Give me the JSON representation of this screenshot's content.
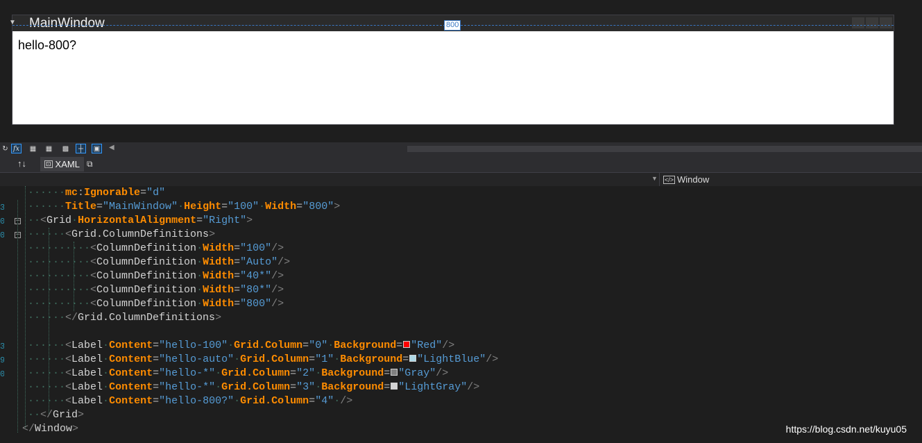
{
  "designer": {
    "window_title": "MainWindow",
    "content_label": "hello-800?",
    "width_badge": "800"
  },
  "toolbar": {
    "icons": [
      "refresh-icon",
      "fx-icon",
      "grid-icon",
      "snap-grid-icon",
      "checkerboard-icon",
      "snap-lines-icon",
      "device-icon"
    ],
    "fx_label": "fx"
  },
  "tabs": {
    "swap_label": "↑↓",
    "xaml_label": "XAML"
  },
  "nav": {
    "right_value": "Window"
  },
  "code": {
    "line_numbers": [
      "",
      "3",
      "0",
      "0",
      "",
      "",
      "",
      "",
      "",
      "",
      "",
      "3",
      "9",
      "0",
      "",
      "",
      "",
      ""
    ],
    "lines": [
      [
        {
          "t": "dots",
          "v": "······"
        },
        {
          "t": "at",
          "v": "mc"
        },
        {
          "t": "eq",
          "v": ":"
        },
        {
          "t": "at",
          "v": "Ignorable"
        },
        {
          "t": "eq",
          "v": "="
        },
        {
          "t": "val",
          "v": "\"d\""
        }
      ],
      [
        {
          "t": "dots",
          "v": "······"
        },
        {
          "t": "at",
          "v": "Title"
        },
        {
          "t": "eq",
          "v": "="
        },
        {
          "t": "val",
          "v": "\"MainWindow\""
        },
        {
          "t": "dots",
          "v": "·"
        },
        {
          "t": "at",
          "v": "Height"
        },
        {
          "t": "eq",
          "v": "="
        },
        {
          "t": "val",
          "v": "\"100\""
        },
        {
          "t": "dots",
          "v": "·"
        },
        {
          "t": "at",
          "v": "Width"
        },
        {
          "t": "eq",
          "v": "="
        },
        {
          "t": "val",
          "v": "\"800\""
        },
        {
          "t": "pn",
          "v": ">"
        }
      ],
      [
        {
          "t": "dots",
          "v": "··"
        },
        {
          "t": "pn",
          "v": "<"
        },
        {
          "t": "el",
          "v": "Grid"
        },
        {
          "t": "dots",
          "v": "·"
        },
        {
          "t": "at",
          "v": "HorizontalAlignment"
        },
        {
          "t": "eq",
          "v": "="
        },
        {
          "t": "val",
          "v": "\"Right\""
        },
        {
          "t": "pn",
          "v": ">"
        }
      ],
      [
        {
          "t": "dots",
          "v": "······"
        },
        {
          "t": "pn",
          "v": "<"
        },
        {
          "t": "el",
          "v": "Grid.ColumnDefinitions"
        },
        {
          "t": "pn",
          "v": ">"
        }
      ],
      [
        {
          "t": "dots",
          "v": "··········"
        },
        {
          "t": "pn",
          "v": "<"
        },
        {
          "t": "el",
          "v": "ColumnDefinition"
        },
        {
          "t": "dots",
          "v": "·"
        },
        {
          "t": "at",
          "v": "Width"
        },
        {
          "t": "eq",
          "v": "="
        },
        {
          "t": "val",
          "v": "\"100\""
        },
        {
          "t": "pn",
          "v": "/>"
        }
      ],
      [
        {
          "t": "dots",
          "v": "··········"
        },
        {
          "t": "pn",
          "v": "<"
        },
        {
          "t": "el",
          "v": "ColumnDefinition"
        },
        {
          "t": "dots",
          "v": "·"
        },
        {
          "t": "at",
          "v": "Width"
        },
        {
          "t": "eq",
          "v": "="
        },
        {
          "t": "val",
          "v": "\"Auto\""
        },
        {
          "t": "pn",
          "v": "/>"
        }
      ],
      [
        {
          "t": "dots",
          "v": "··········"
        },
        {
          "t": "pn",
          "v": "<"
        },
        {
          "t": "el",
          "v": "ColumnDefinition"
        },
        {
          "t": "dots",
          "v": "·"
        },
        {
          "t": "at",
          "v": "Width"
        },
        {
          "t": "eq",
          "v": "="
        },
        {
          "t": "val",
          "v": "\"40*\""
        },
        {
          "t": "pn",
          "v": "/>"
        }
      ],
      [
        {
          "t": "dots",
          "v": "··········"
        },
        {
          "t": "pn",
          "v": "<"
        },
        {
          "t": "el",
          "v": "ColumnDefinition"
        },
        {
          "t": "dots",
          "v": "·"
        },
        {
          "t": "at",
          "v": "Width"
        },
        {
          "t": "eq",
          "v": "="
        },
        {
          "t": "val",
          "v": "\"80*\""
        },
        {
          "t": "pn",
          "v": "/>"
        }
      ],
      [
        {
          "t": "dots",
          "v": "··········"
        },
        {
          "t": "pn",
          "v": "<"
        },
        {
          "t": "el",
          "v": "ColumnDefinition"
        },
        {
          "t": "dots",
          "v": "·"
        },
        {
          "t": "at",
          "v": "Width"
        },
        {
          "t": "eq",
          "v": "="
        },
        {
          "t": "val",
          "v": "\"800\""
        },
        {
          "t": "pn",
          "v": "/>"
        }
      ],
      [
        {
          "t": "dots",
          "v": "······"
        },
        {
          "t": "pn",
          "v": "</"
        },
        {
          "t": "el",
          "v": "Grid.ColumnDefinitions"
        },
        {
          "t": "pn",
          "v": ">"
        }
      ],
      [],
      [
        {
          "t": "dots",
          "v": "······"
        },
        {
          "t": "pn",
          "v": "<"
        },
        {
          "t": "el",
          "v": "Label"
        },
        {
          "t": "dots",
          "v": "·"
        },
        {
          "t": "at",
          "v": "Content"
        },
        {
          "t": "eq",
          "v": "="
        },
        {
          "t": "val",
          "v": "\"hello-100\""
        },
        {
          "t": "dots",
          "v": "·"
        },
        {
          "t": "at",
          "v": "Grid.Column"
        },
        {
          "t": "eq",
          "v": "="
        },
        {
          "t": "val",
          "v": "\"0\""
        },
        {
          "t": "dots",
          "v": "·"
        },
        {
          "t": "at",
          "v": "Background"
        },
        {
          "t": "eq",
          "v": "="
        },
        {
          "t": "sw",
          "v": "#ff0000"
        },
        {
          "t": "val",
          "v": "\"Red\""
        },
        {
          "t": "pn",
          "v": "/>"
        }
      ],
      [
        {
          "t": "dots",
          "v": "······"
        },
        {
          "t": "pn",
          "v": "<"
        },
        {
          "t": "el",
          "v": "Label"
        },
        {
          "t": "dots",
          "v": "·"
        },
        {
          "t": "at",
          "v": "Content"
        },
        {
          "t": "eq",
          "v": "="
        },
        {
          "t": "val",
          "v": "\"hello-auto\""
        },
        {
          "t": "dots",
          "v": "·"
        },
        {
          "t": "at",
          "v": "Grid.Column"
        },
        {
          "t": "eq",
          "v": "="
        },
        {
          "t": "val",
          "v": "\"1\""
        },
        {
          "t": "dots",
          "v": "·"
        },
        {
          "t": "at",
          "v": "Background"
        },
        {
          "t": "eq",
          "v": "="
        },
        {
          "t": "sw",
          "v": "#add8e6"
        },
        {
          "t": "val",
          "v": "\"LightBlue\""
        },
        {
          "t": "pn",
          "v": "/>"
        }
      ],
      [
        {
          "t": "dots",
          "v": "······"
        },
        {
          "t": "pn",
          "v": "<"
        },
        {
          "t": "el",
          "v": "Label"
        },
        {
          "t": "dots",
          "v": "·"
        },
        {
          "t": "at",
          "v": "Content"
        },
        {
          "t": "eq",
          "v": "="
        },
        {
          "t": "val",
          "v": "\"hello-*\""
        },
        {
          "t": "dots",
          "v": "·"
        },
        {
          "t": "at",
          "v": "Grid.Column"
        },
        {
          "t": "eq",
          "v": "="
        },
        {
          "t": "val",
          "v": "\"2\""
        },
        {
          "t": "dots",
          "v": "·"
        },
        {
          "t": "at",
          "v": "Background"
        },
        {
          "t": "eq",
          "v": "="
        },
        {
          "t": "sw",
          "v": "#808080"
        },
        {
          "t": "val",
          "v": "\"Gray\""
        },
        {
          "t": "pn",
          "v": "/>"
        }
      ],
      [
        {
          "t": "dots",
          "v": "······"
        },
        {
          "t": "pn",
          "v": "<"
        },
        {
          "t": "el",
          "v": "Label"
        },
        {
          "t": "dots",
          "v": "·"
        },
        {
          "t": "at",
          "v": "Content"
        },
        {
          "t": "eq",
          "v": "="
        },
        {
          "t": "val",
          "v": "\"hello-*\""
        },
        {
          "t": "dots",
          "v": "·"
        },
        {
          "t": "at",
          "v": "Grid.Column"
        },
        {
          "t": "eq",
          "v": "="
        },
        {
          "t": "val",
          "v": "\"3\""
        },
        {
          "t": "dots",
          "v": "·"
        },
        {
          "t": "at",
          "v": "Background"
        },
        {
          "t": "eq",
          "v": "="
        },
        {
          "t": "sw",
          "v": "#d3d3d3"
        },
        {
          "t": "val",
          "v": "\"LightGray\""
        },
        {
          "t": "pn",
          "v": "/>"
        }
      ],
      [
        {
          "t": "dots",
          "v": "······"
        },
        {
          "t": "pn",
          "v": "<"
        },
        {
          "t": "el",
          "v": "Label"
        },
        {
          "t": "dots",
          "v": "·"
        },
        {
          "t": "at",
          "v": "Content"
        },
        {
          "t": "eq",
          "v": "="
        },
        {
          "t": "val",
          "v": "\"hello-800?\""
        },
        {
          "t": "dots",
          "v": "·"
        },
        {
          "t": "at",
          "v": "Grid.Column"
        },
        {
          "t": "eq",
          "v": "="
        },
        {
          "t": "val",
          "v": "\"4\""
        },
        {
          "t": "dots",
          "v": "·"
        },
        {
          "t": "pn",
          "v": "/>"
        }
      ],
      [
        {
          "t": "dots",
          "v": "··"
        },
        {
          "t": "pn",
          "v": "</"
        },
        {
          "t": "el",
          "v": "Grid"
        },
        {
          "t": "pn",
          "v": ">"
        }
      ],
      [
        {
          "t": "pn",
          "v": "</"
        },
        {
          "t": "el",
          "v": "Window"
        },
        {
          "t": "pn",
          "v": ">"
        }
      ]
    ]
  },
  "watermark": "https://blog.csdn.net/kuyu05",
  "colors": {
    "attribute": "#ff8c00",
    "value": "#569cd6",
    "element": "#d4d4d4",
    "accent": "#3399ff"
  }
}
